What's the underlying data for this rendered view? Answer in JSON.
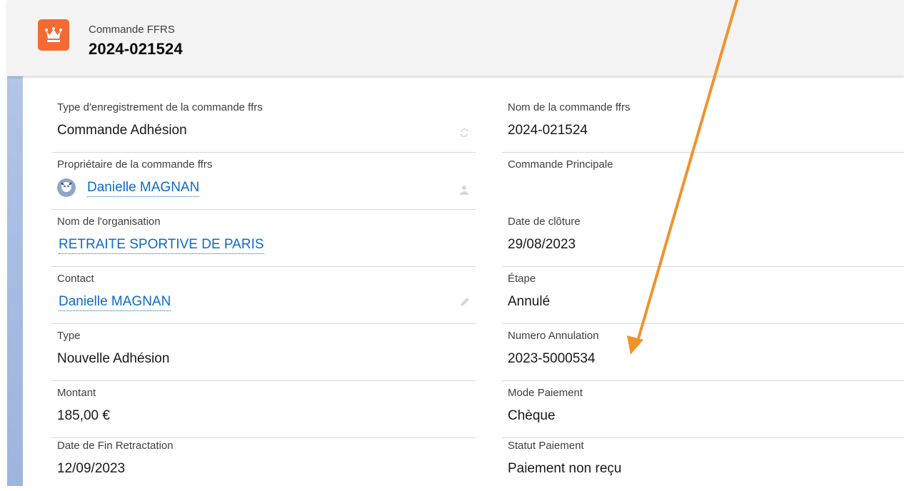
{
  "header": {
    "object_type": "Commande FFRS",
    "record_name": "2024-021524",
    "icon": "crown-icon",
    "icon_color": "#f46a34"
  },
  "fields_left": [
    {
      "label": "Type d'enregistrement de la commande ffrs",
      "value": "Commande Adhésion",
      "link": false,
      "icon": "change-record-type-icon"
    },
    {
      "label": "Propriétaire de la commande ffrs",
      "value": "Danielle MAGNAN",
      "link": true,
      "icon": "change-owner-icon"
    },
    {
      "label": "Nom de l'organisation",
      "value": "RETRAITE SPORTIVE DE PARIS",
      "link": true
    },
    {
      "label": "Contact",
      "value": "Danielle MAGNAN",
      "link": true,
      "icon": "pencil-icon"
    },
    {
      "label": "Type",
      "value": "Nouvelle Adhésion",
      "link": false
    },
    {
      "label": "Montant",
      "value": "185,00 €",
      "link": false
    },
    {
      "label": "Date de Fin Retractation",
      "value": "12/09/2023",
      "link": false
    }
  ],
  "fields_right": [
    {
      "label": "Nom de la commande ffrs",
      "value": "2024-021524"
    },
    {
      "label": "Commande Principale",
      "value": ""
    },
    {
      "label": "Date de clôture",
      "value": "29/08/2023"
    },
    {
      "label": "Étape",
      "value": "Annulé"
    },
    {
      "label": "Numero Annulation",
      "value": "2023-5000534"
    },
    {
      "label": "Mode Paiement",
      "value": "Chèque"
    },
    {
      "label": "Statut Paiement",
      "value": "Paiement non reçu"
    }
  ],
  "colors": {
    "link": "#0b6bcb",
    "annotation_arrow": "#f0932b"
  }
}
